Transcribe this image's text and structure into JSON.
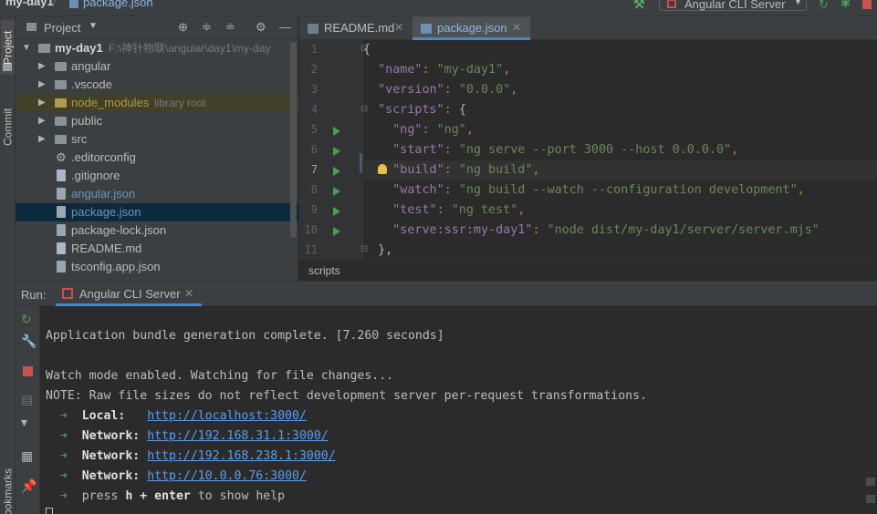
{
  "window": {
    "project_name": "my-day1",
    "separator": "/",
    "current_file": "package.json",
    "run_config": "Angular CLI Server"
  },
  "tool_stripe": {
    "project": "Project",
    "commit": "Commit",
    "bookmarks": "Bookmarks"
  },
  "project_panel": {
    "title": "Project",
    "root_name": "my-day1",
    "root_path": "F:\\神针物联\\angular\\day1\\my-day",
    "items": [
      {
        "label": "angular"
      },
      {
        "label": ".vscode"
      },
      {
        "label": "node_modules",
        "extra": "library root"
      },
      {
        "label": "public"
      },
      {
        "label": "src"
      },
      {
        "label": ".editorconfig"
      },
      {
        "label": ".gitignore"
      },
      {
        "label": "angular.json"
      },
      {
        "label": "package.json"
      },
      {
        "label": "package-lock.json"
      },
      {
        "label": "README.md"
      },
      {
        "label": "tsconfig.app.json"
      }
    ]
  },
  "editor": {
    "tabs": [
      {
        "label": "README.md"
      },
      {
        "label": "package.json"
      }
    ],
    "line_numbers": [
      "1",
      "2",
      "3",
      "4",
      "5",
      "6",
      "7",
      "8",
      "9",
      "10",
      "11"
    ],
    "code": {
      "l1": "{",
      "k_name": "\"name\"",
      "v_name": "\"my-day1\"",
      "k_version": "\"version\"",
      "v_version": "\"0.0.0\"",
      "k_scripts": "\"scripts\"",
      "k_ng": "\"ng\"",
      "v_ng": "\"ng\"",
      "k_start": "\"start\"",
      "v_start": "\"ng serve --port 3000 --host 0.0.0.0\"",
      "k_build": "\"build\"",
      "v_build": "\"ng build\"",
      "k_watch": "\"watch\"",
      "v_watch": "\"ng build --watch --configuration development\"",
      "k_test": "\"test\"",
      "v_test": "\"ng test\"",
      "k_serve": "\"serve:ssr:my-day1\"",
      "v_serve": "\"node dist/my-day1/server/server.mjs\"",
      "l11": "},"
    },
    "breadcrumb": "scripts"
  },
  "run_panel": {
    "label": "Run:",
    "tab": "Angular CLI Server",
    "console": {
      "line1": "Application bundle generation complete. [7.260 seconds]",
      "line2": "Watch mode enabled. Watching for file changes...",
      "line3": "NOTE: Raw file sizes do not reflect development server per-request transformations.",
      "arrow": "➜",
      "local_label": "Local:",
      "local_url": "http://localhost:3000/",
      "network_label": "Network:",
      "net1": "http://192.168.31.1:3000/",
      "net2": "http://192.168.238.1:3000/",
      "net3": "http://10.0.0.76:3000/",
      "help_pre": "press",
      "help_key": "h + enter",
      "help_post": "to show help"
    }
  },
  "colors": {
    "accent": "#4a88c7",
    "run_green": "#499c54",
    "stop_red": "#c75450",
    "link": "#589df6"
  }
}
